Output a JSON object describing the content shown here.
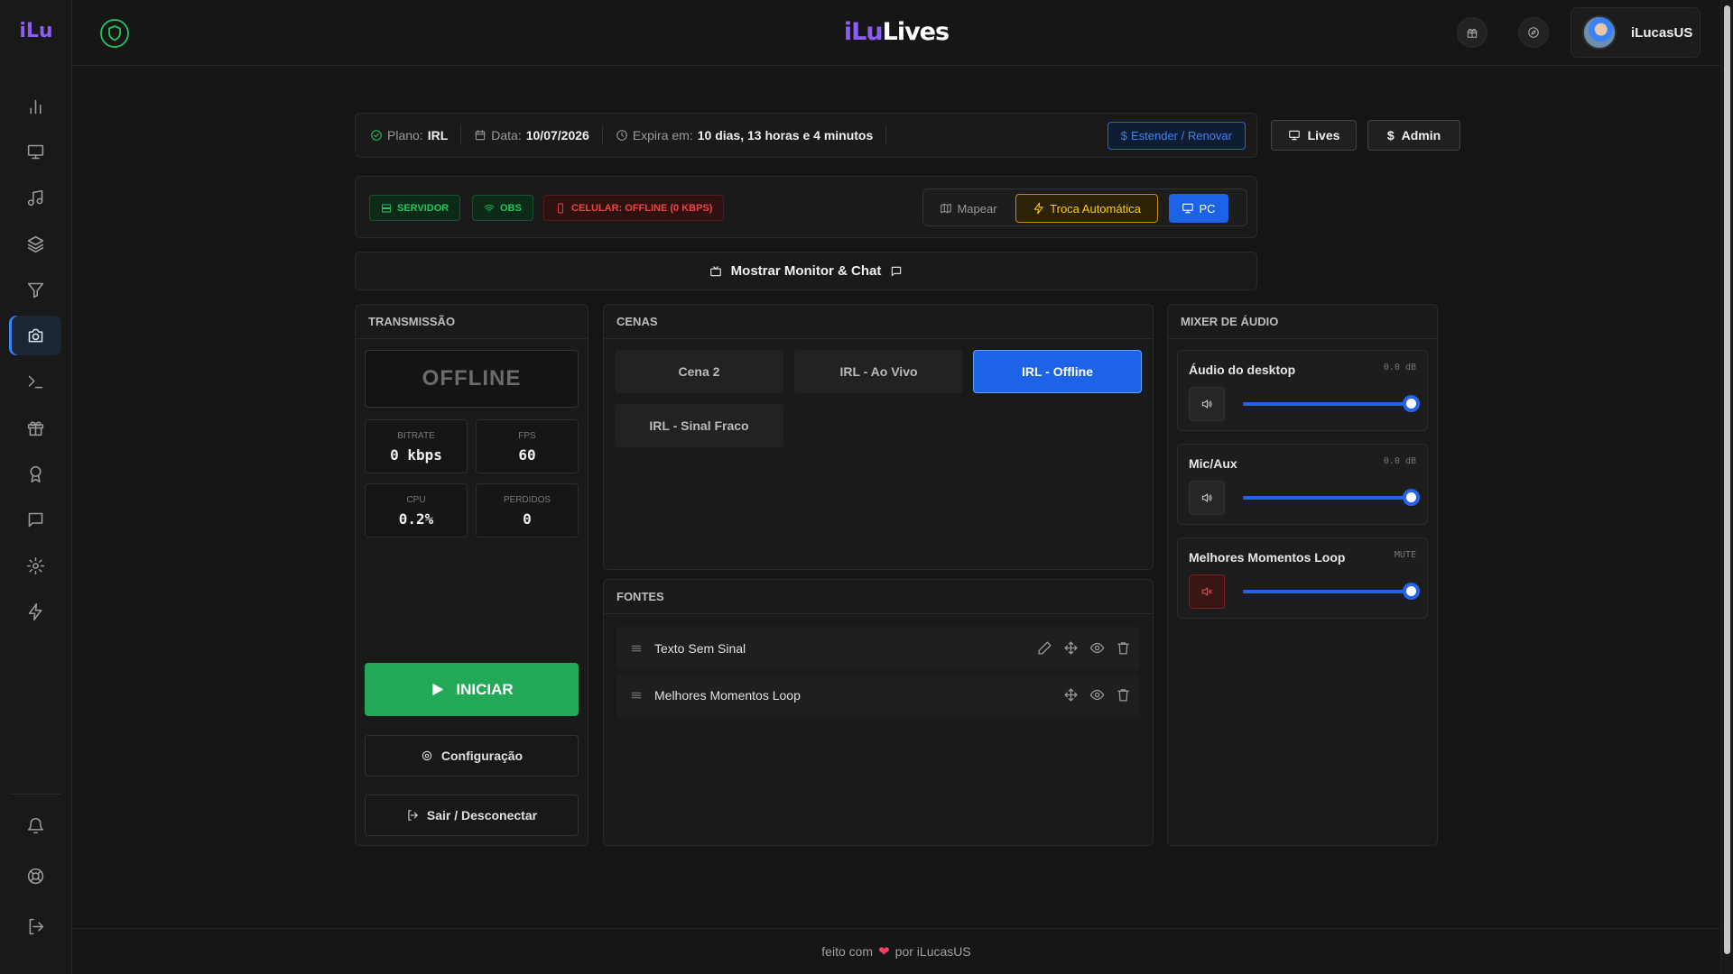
{
  "sidebar": {
    "logo": "iLu",
    "items": [
      {
        "name": "bar-chart-icon"
      },
      {
        "name": "monitor-icon"
      },
      {
        "name": "music-icon"
      },
      {
        "name": "layers-icon"
      },
      {
        "name": "filter-icon"
      },
      {
        "name": "camera-icon",
        "active": true
      },
      {
        "name": "terminal-icon"
      },
      {
        "name": "gift-icon"
      },
      {
        "name": "award-icon"
      },
      {
        "name": "chat-icon"
      },
      {
        "name": "gear-icon"
      },
      {
        "name": "zap-icon"
      }
    ],
    "bottom_items": [
      {
        "name": "bell-icon"
      },
      {
        "name": "lifebuoy-icon"
      },
      {
        "name": "logout-icon"
      }
    ]
  },
  "header": {
    "brand_prefix": "iLu",
    "brand_suffix": "Lives",
    "username": "iLucasUS"
  },
  "plan": {
    "plan_label": "Plano:",
    "plan_value": "IRL",
    "date_label": "Data:",
    "date_value": "10/07/2026",
    "expires_label": "Expira em:",
    "expires_value": "10 dias, 13 horas e 4 minutos",
    "extend_label": "Estender / Renovar"
  },
  "top_buttons": {
    "lives_label": "Lives",
    "admin_label": "Admin"
  },
  "status": {
    "server_label": "SERVIDOR",
    "obs_label": "OBS",
    "cel_label": "CELULAR: OFFLINE (0 KBPS)",
    "mode_mapear": "Mapear",
    "mode_troca": "Troca Automática",
    "mode_pc": "PC"
  },
  "monitor_bar": {
    "label": "Mostrar Monitor & Chat"
  },
  "transmissao": {
    "title": "TRANSMISSÃO",
    "state": "OFFLINE",
    "stats": [
      {
        "label": "BITRATE",
        "value": "0 kbps"
      },
      {
        "label": "FPS",
        "value": "60"
      },
      {
        "label": "CPU",
        "value": "0.2%"
      },
      {
        "label": "PERDIDOS",
        "value": "0"
      }
    ],
    "start_label": "INICIAR",
    "config_label": "Configuração",
    "logout_label": "Sair / Desconectar"
  },
  "cenas": {
    "title": "CENAS",
    "items": [
      {
        "label": "Cena 2",
        "active": false
      },
      {
        "label": "IRL - Ao Vivo",
        "active": false
      },
      {
        "label": "IRL - Offline",
        "active": true
      },
      {
        "label": "IRL - Sinal Fraco",
        "active": false
      }
    ]
  },
  "fontes": {
    "title": "FONTES",
    "items": [
      {
        "label": "Texto Sem Sinal",
        "editable": true
      },
      {
        "label": "Melhores Momentos Loop",
        "editable": false
      }
    ]
  },
  "mixer": {
    "title": "MIXER DE ÁUDIO",
    "channels": [
      {
        "name": "Áudio do desktop",
        "level": "0.0 dB",
        "muted": false,
        "volume": 1.0
      },
      {
        "name": "Mic/Aux",
        "level": "0.0 dB",
        "muted": false,
        "volume": 1.0
      },
      {
        "name": "Melhores Momentos Loop",
        "level": "MUTE",
        "muted": true,
        "volume": 1.0
      }
    ]
  },
  "footer": {
    "prefix": "feito com",
    "suffix": "por iLucasUS"
  },
  "colors": {
    "accent": "#1d63e8",
    "brand": "#8b5cf6",
    "success": "#22c55e",
    "danger": "#ef4444",
    "warning": "#facc15"
  }
}
